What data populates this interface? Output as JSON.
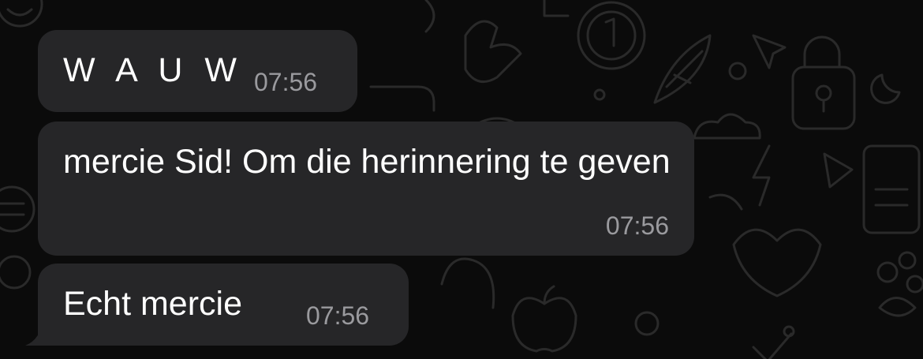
{
  "messages": [
    {
      "text": "W A U W",
      "time": "07:56"
    },
    {
      "text": "mercie Sid! Om die herinnering te geven",
      "time": "07:56"
    },
    {
      "text": "Echt mercie",
      "time": "07:56"
    }
  ],
  "colors": {
    "background": "#0b0b0b",
    "bubble": "#262628",
    "text": "#ffffff",
    "timestamp": "#9a9a9e",
    "pattern": "#2a2a2a"
  }
}
